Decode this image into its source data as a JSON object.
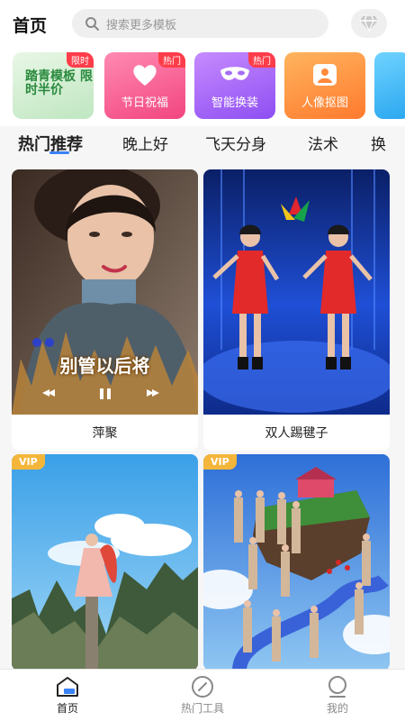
{
  "header": {
    "title": "首页",
    "search_placeholder": "搜索更多模板"
  },
  "categories": [
    {
      "label": "踏青模板 限时半价",
      "tag": "限时"
    },
    {
      "label": "节日祝福",
      "tag": "热门"
    },
    {
      "label": "智能换装",
      "tag": "热门"
    },
    {
      "label": "人像抠图",
      "tag": ""
    }
  ],
  "tabs": [
    "热门推荐",
    "晚上好",
    "飞天分身",
    "法术",
    "换"
  ],
  "cards": [
    {
      "name": "萍聚",
      "caption": "别管以后将",
      "vip": ""
    },
    {
      "name": "双人踢毽子",
      "caption": "",
      "vip": ""
    },
    {
      "name": "",
      "caption": "",
      "vip": "VIP"
    },
    {
      "name": "",
      "caption": "",
      "vip": "VIP"
    }
  ],
  "bottom_nav": [
    {
      "label": "首页",
      "icon": "home-icon",
      "active": true
    },
    {
      "label": "热门工具",
      "icon": "compass-icon",
      "active": false
    },
    {
      "label": "我的",
      "icon": "profile-icon",
      "active": false
    }
  ],
  "colors": {
    "accent": "#3b82f6",
    "hot_tag": "#ff3d4a",
    "vip": "#f4b63a"
  }
}
